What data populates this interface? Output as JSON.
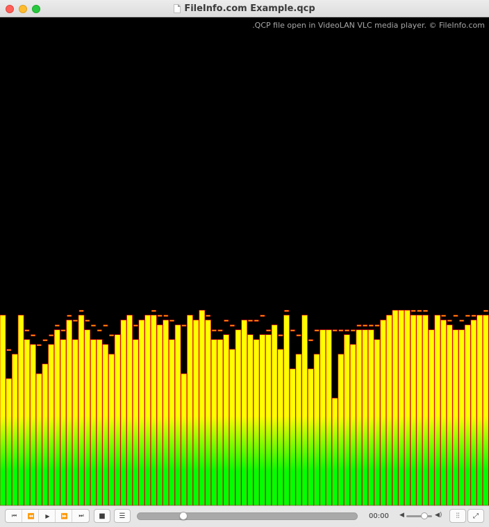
{
  "window": {
    "title": "FileInfo.com Example.qcp",
    "file_icon": "document-icon"
  },
  "video": {
    "watermark": ".QCP file open in VideoLAN VLC media player. © FileInfo.com",
    "visualization": {
      "type": "spectrum",
      "bar_levels": [
        0.39,
        0.26,
        0.31,
        0.39,
        0.34,
        0.33,
        0.27,
        0.29,
        0.33,
        0.36,
        0.34,
        0.38,
        0.34,
        0.39,
        0.36,
        0.34,
        0.34,
        0.33,
        0.31,
        0.35,
        0.38,
        0.39,
        0.34,
        0.38,
        0.39,
        0.39,
        0.37,
        0.38,
        0.34,
        0.37,
        0.27,
        0.39,
        0.38,
        0.4,
        0.38,
        0.34,
        0.34,
        0.35,
        0.32,
        0.36,
        0.38,
        0.35,
        0.34,
        0.35,
        0.35,
        0.37,
        0.32,
        0.39,
        0.28,
        0.31,
        0.39,
        0.28,
        0.31,
        0.36,
        0.36,
        0.22,
        0.31,
        0.35,
        0.33,
        0.36,
        0.36,
        0.36,
        0.34,
        0.38,
        0.39,
        0.4,
        0.4,
        0.4,
        0.39,
        0.39,
        0.39,
        0.36,
        0.39,
        0.38,
        0.37,
        0.36,
        0.36,
        0.37,
        0.38,
        0.39,
        0.39
      ],
      "peak_levels": [
        0.39,
        0.32,
        0.31,
        0.39,
        0.36,
        0.35,
        0.33,
        0.34,
        0.35,
        0.37,
        0.36,
        0.39,
        0.38,
        0.4,
        0.38,
        0.37,
        0.36,
        0.37,
        0.35,
        0.35,
        0.38,
        0.39,
        0.37,
        0.38,
        0.39,
        0.4,
        0.39,
        0.39,
        0.38,
        0.37,
        0.37,
        0.39,
        0.38,
        0.4,
        0.39,
        0.36,
        0.36,
        0.38,
        0.37,
        0.36,
        0.38,
        0.38,
        0.38,
        0.39,
        0.36,
        0.35,
        0.35,
        0.4,
        0.36,
        0.35,
        0.39,
        0.34,
        0.36,
        0.36,
        0.36,
        0.36,
        0.36,
        0.36,
        0.36,
        0.37,
        0.37,
        0.37,
        0.37,
        0.38,
        0.39,
        0.4,
        0.4,
        0.4,
        0.4,
        0.4,
        0.4,
        0.36,
        0.39,
        0.39,
        0.38,
        0.39,
        0.38,
        0.39,
        0.39,
        0.39,
        0.4
      ],
      "colors": {
        "top": "#ffff00",
        "mid": "#ffff00",
        "bottom": "#00ff00",
        "outline": "#e0001a",
        "peak": "#ffa500",
        "background": "#000000"
      }
    }
  },
  "controls": {
    "transport": [
      {
        "name": "skip-back-button",
        "icon": "⏮"
      },
      {
        "name": "rewind-button",
        "icon": "⏪"
      },
      {
        "name": "play-button",
        "icon": "▶"
      },
      {
        "name": "fast-forward-button",
        "icon": "⏩"
      },
      {
        "name": "skip-forward-button",
        "icon": "⏭"
      }
    ],
    "stop_icon": "■",
    "playlist_icon": "☰",
    "elapsed_time": "00:00",
    "timeline_progress": 0.21,
    "volume_level": 0.7,
    "volume_low_icon": "◀",
    "volume_high_icon": "◀)",
    "equalizer_icon": "⫶⫶",
    "fullscreen_icon": "⤢"
  }
}
